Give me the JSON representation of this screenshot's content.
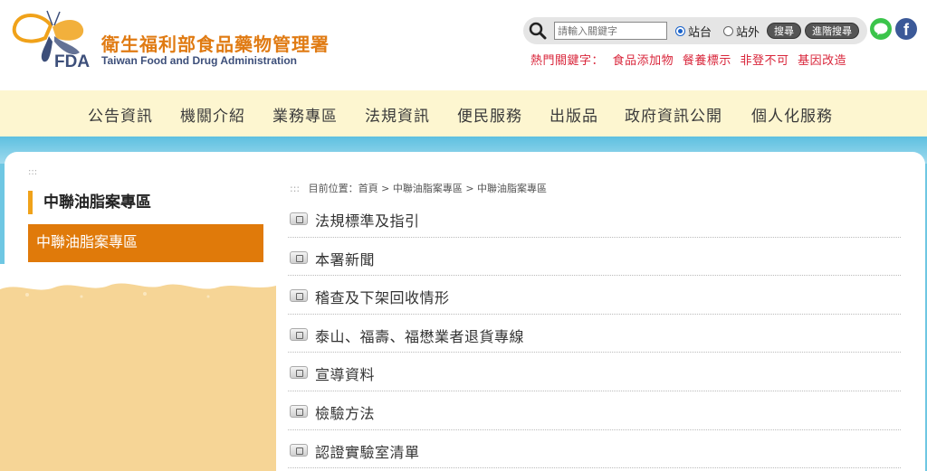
{
  "header": {
    "org_name_zh": "衛生福利部食品藥物管理署",
    "org_name_en": "Taiwan Food and Drug Administration",
    "logo_text": "FDA"
  },
  "search": {
    "placeholder": "請輸入關鍵字",
    "radio_site": "站台",
    "radio_external": "站外",
    "search_button": "搜尋",
    "advanced_button": "進階搜尋"
  },
  "hot_keywords": {
    "label": "熱門關鍵字：",
    "items": [
      "食品添加物",
      "餐養標示",
      "非登不可",
      "基因改造"
    ]
  },
  "nav": {
    "items": [
      "公告資訊",
      "機關介紹",
      "業務專區",
      "法規資訊",
      "便民服務",
      "出版品",
      "政府資訊公開",
      "個人化服務"
    ]
  },
  "sidebar": {
    "dots": ":::",
    "title": "中聯油脂案專區",
    "active_item": "中聯油脂案專區"
  },
  "breadcrumb": {
    "dots": ":::",
    "text": "目前位置：首頁 > 中聯油脂案專區 > 中聯油脂案專區"
  },
  "list": {
    "items": [
      "法規標準及指引",
      "本署新聞",
      "稽查及下架回收情形",
      "泰山、福壽、福懋業者退貨專線",
      "宣導資料",
      "檢驗方法",
      "認證實驗室清單"
    ]
  },
  "social": {
    "facebook_glyph": "f"
  },
  "colors": {
    "nav_bg": "#fdf6d0",
    "accent_orange": "#e07a0a",
    "banner_blue": "#6fc7e3",
    "keyword_red": "#d9263b"
  }
}
